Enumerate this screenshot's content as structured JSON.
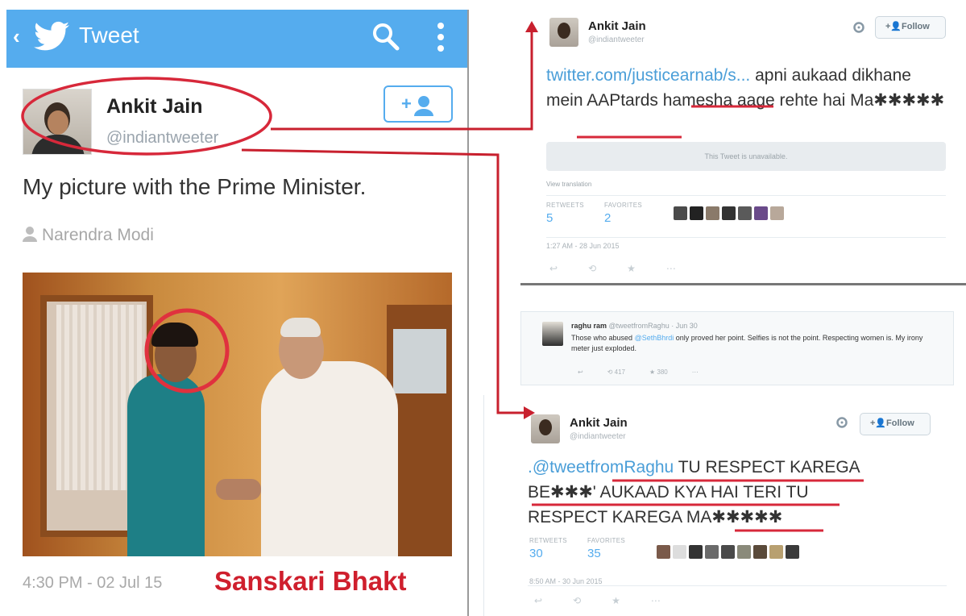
{
  "left": {
    "appbar": {
      "back": "‹",
      "title": "Tweet"
    },
    "tweet": {
      "name": "Ankit Jain",
      "handle": "@indiantweeter",
      "text": "My picture with the Prime Minister.",
      "tagged": "Narendra Modi",
      "timestamp": "4:30 PM - 02 Jul 15"
    },
    "caption": "Sanskari Bhakt",
    "caption_color": "#cf1f2d",
    "accent": "#55acee"
  },
  "card1": {
    "name": "Ankit Jain",
    "handle": "@indiantweeter",
    "follow": "Follow",
    "text_link": "twitter.com/justicearnab/s...",
    "text_rest_1": " apni aukaad dikhane mein ",
    "text_underlined": "AAPtards ham",
    "text_rest_2": "esha aage rehte hai ",
    "text_masked": "Ma✱✱✱✱✱",
    "unavailable": "This Tweet is unavailable.",
    "translation": "View translation",
    "retweets_label": "RETWEETS",
    "retweets": "5",
    "favorites_label": "FAVORITES",
    "favorites": "2",
    "timestamp": "1:27 AM - 28 Jun 2015"
  },
  "reply": {
    "name": "raghu ram",
    "meta": "@tweetfromRaghu · Jun 30",
    "text_1": "Those who abused ",
    "mention": "@SethBhrdi",
    "text_2": " only proved her point. Selfies is not the point. Respecting women is. My irony meter just exploded.",
    "retweets": "417",
    "favorites": "380"
  },
  "card2": {
    "name": "Ankit Jain",
    "handle": "@indiantweeter",
    "follow": "Follow",
    "mention": ".@tweetfromRaghu",
    "line1_rest": " TU RESPECT KAREGA",
    "line2": "BE✱✱✱' AUKAAD KYA HAI TERI TU",
    "line3": "RESPECT KAREGA MA✱✱✱✱✱",
    "retweets_label": "RETWEETS",
    "retweets": "30",
    "favorites_label": "FAVORITES",
    "favorites": "35",
    "timestamp": "8:50 AM - 30 Jun 2015"
  },
  "icons": [
    "back-chevron-icon",
    "twitter-bird-icon",
    "search-icon",
    "more-vertical-icon",
    "add-user-icon",
    "person-tag-icon",
    "gear-icon",
    "reply-icon",
    "retweet-icon",
    "favorite-icon",
    "more-icon"
  ],
  "colors": {
    "twitter_blue": "#55acee",
    "annotation_red": "#cf1f2d",
    "link_blue": "#4a9ed8"
  }
}
